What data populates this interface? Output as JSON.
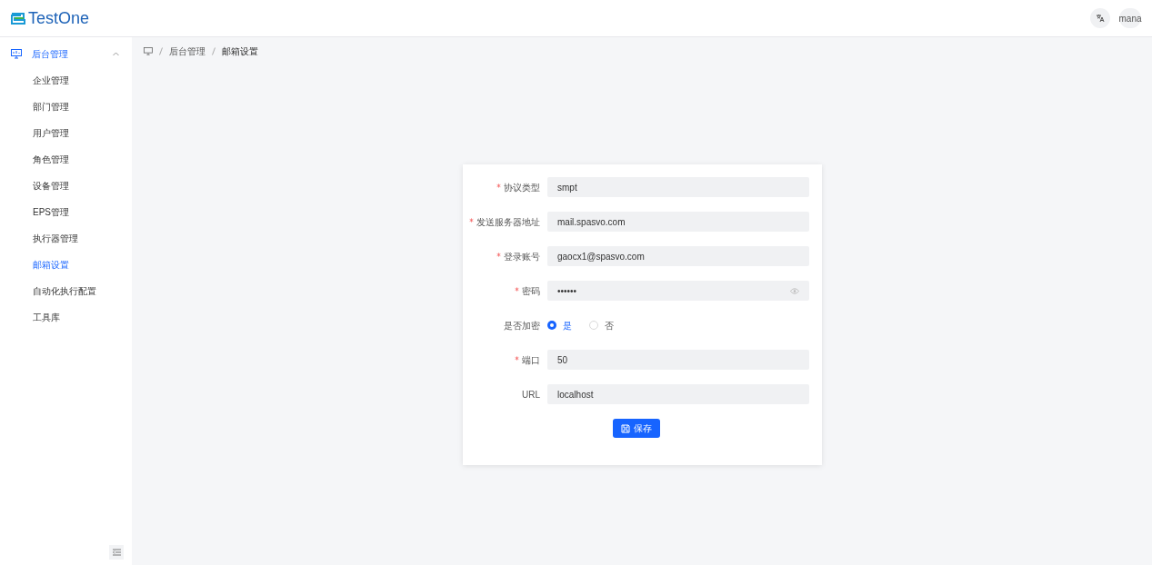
{
  "header": {
    "logo_text": "TestOne",
    "user": "mana"
  },
  "sidebar": {
    "groups": [
      {
        "label": "后台管理",
        "expanded": true,
        "selected": true,
        "children": [
          {
            "label": "企业管理",
            "selected": false
          },
          {
            "label": "部门管理",
            "selected": false
          },
          {
            "label": "用户管理",
            "selected": false
          },
          {
            "label": "角色管理",
            "selected": false
          },
          {
            "label": "设备管理",
            "selected": false
          },
          {
            "label": "EPS管理",
            "selected": false
          },
          {
            "label": "执行器管理",
            "selected": false
          },
          {
            "label": "邮箱设置",
            "selected": true
          },
          {
            "label": "自动化执行配置",
            "selected": false
          },
          {
            "label": "工具库",
            "selected": false
          }
        ]
      }
    ]
  },
  "breadcrumb": [
    "后台管理",
    "邮箱设置"
  ],
  "form": {
    "fields": [
      {
        "kind": "text",
        "label": "协议类型",
        "required": true,
        "value": "smpt"
      },
      {
        "kind": "text",
        "label": "发送服务器地址",
        "required": true,
        "value": "mail.spasvo.com"
      },
      {
        "kind": "text",
        "label": "登录账号",
        "required": true,
        "value": "gaocx1@spasvo.com"
      },
      {
        "kind": "password",
        "label": "密码",
        "required": true,
        "value": "••••••"
      },
      {
        "kind": "radio",
        "label": "是否加密",
        "required": false,
        "options": [
          {
            "label": "是",
            "selected": true
          },
          {
            "label": "否",
            "selected": false
          }
        ]
      },
      {
        "kind": "text",
        "label": "端口",
        "required": true,
        "value": "50"
      },
      {
        "kind": "text",
        "label": "URL",
        "required": false,
        "value": "localhost"
      }
    ],
    "submit": "保存"
  }
}
